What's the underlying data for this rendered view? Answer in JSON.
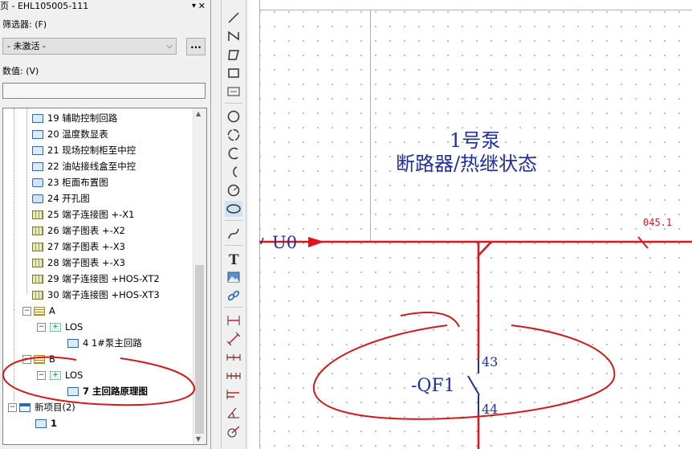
{
  "panel": {
    "title": "页 - EHL105005-111",
    "filter_label": "筛选器: (F)",
    "filter_value": "- 未激活 -",
    "filter_button": "...",
    "value_label": "数值: (V)",
    "value_input": ""
  },
  "tree": {
    "items": [
      {
        "label": "19 辅助控制回路"
      },
      {
        "label": "20 温度数显表"
      },
      {
        "label": "21 现场控制柜至中控"
      },
      {
        "label": "22 油站接线盒至中控"
      },
      {
        "label": "23 柜面布置图"
      },
      {
        "label": "24 开孔图"
      },
      {
        "label": "25 端子连接图 +-X1"
      },
      {
        "label": "26 端子图表 +-X2"
      },
      {
        "label": "27 端子图表 +-X3"
      },
      {
        "label": "28 端子图表 +-X3"
      },
      {
        "label": "29 端子连接图 +HOS-XT2"
      },
      {
        "label": "30 端子连接图 +HOS-XT3"
      },
      {
        "label": "A"
      },
      {
        "label": "LOS"
      },
      {
        "label": "4 1#泵主回路"
      },
      {
        "label": "B"
      },
      {
        "label": "LOS"
      },
      {
        "label": "7 主回路原理图"
      },
      {
        "label": "新项目(2)"
      },
      {
        "label": "1"
      }
    ]
  },
  "canvas": {
    "title_line1": "1号泵",
    "title_line2": "断路器/热继状态",
    "signal_label": "U0",
    "ref_label": "045.1",
    "device_label": "-QF1",
    "pin_top": "43",
    "pin_bottom": "44"
  },
  "colors": {
    "wire": "#e0141a",
    "text_blue": "#1f2fa0",
    "annotation": "#d11a1a"
  },
  "toolbar_icons": [
    "line-icon",
    "polyline-icon",
    "polygon-icon",
    "rectangle-icon",
    "text-field-icon",
    "circle-icon",
    "circle-3pt-icon",
    "arc-icon",
    "arc-2-icon",
    "arc-3-icon",
    "ellipse-icon",
    "spline-icon",
    "text-icon",
    "image-icon",
    "hyperlink-icon",
    "dimension-icon",
    "dimension-angled-icon",
    "dimension-chain-icon",
    "dimension-chain-2-icon",
    "dimension-base-icon",
    "dimension-angle-icon",
    "dimension-radius-icon"
  ]
}
